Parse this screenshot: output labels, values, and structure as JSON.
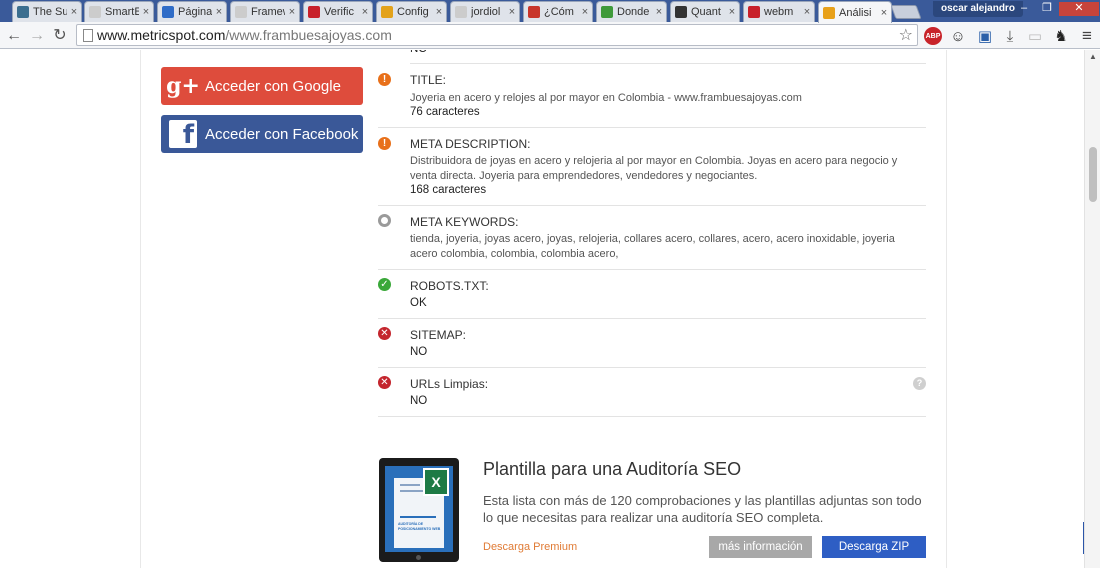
{
  "tabs": [
    {
      "title": "The Su",
      "close": "×",
      "icon": "m-logo-icon",
      "color": "#3b6e8f"
    },
    {
      "title": "SmartE",
      "close": "×",
      "icon": "page-icon",
      "color": "#cccccc"
    },
    {
      "title": "Página",
      "close": "×",
      "icon": "swirl-icon",
      "color": "#2f6cc7"
    },
    {
      "title": "Framew",
      "close": "×",
      "icon": "page-icon",
      "color": "#cccccc"
    },
    {
      "title": "Verific",
      "close": "×",
      "icon": "w-logo-icon",
      "color": "#c8202a"
    },
    {
      "title": "Config",
      "close": "×",
      "icon": "b-logo-icon",
      "color": "#e3a21a"
    },
    {
      "title": "jordiol",
      "close": "×",
      "icon": "page-icon",
      "color": "#cccccc"
    },
    {
      "title": "¿Cóm",
      "close": "×",
      "icon": "bug-icon",
      "color": "#c8352a"
    },
    {
      "title": "Donde",
      "close": "×",
      "icon": "leaf-icon",
      "color": "#3f9a3a"
    },
    {
      "title": "Quant",
      "close": "×",
      "icon": "q-logo-icon",
      "color": "#333333"
    },
    {
      "title": "webm",
      "close": "×",
      "icon": "w-logo-icon",
      "color": "#c8202a"
    },
    {
      "title": "Análisi",
      "close": "×",
      "icon": "circle-logo-icon",
      "color": "#e8a11a"
    }
  ],
  "profile": {
    "name": "oscar alejandro"
  },
  "window_controls": {
    "minimize": "–",
    "maximize": "❐",
    "close": "✕"
  },
  "toolbar": {
    "back": "←",
    "forward": "→",
    "reload": "↻",
    "url_host": "www.metricspot.com",
    "url_path": "/www.frambuesajoyas.com",
    "star": "☆",
    "extensions": [
      {
        "label": "ABP",
        "icon": "adblock-icon"
      },
      {
        "label": "☺",
        "icon": "avatar-extension-icon"
      },
      {
        "label": "▣",
        "icon": "window-extension-icon"
      },
      {
        "label": "⤓",
        "icon": "download-extension-icon"
      },
      {
        "label": "▭",
        "icon": "blank-extension-icon"
      },
      {
        "label": "♞",
        "icon": "ghost-extension-icon"
      }
    ],
    "menu": "≡"
  },
  "login": {
    "google_label": "Acceder con Google",
    "google_icon": "g+",
    "facebook_label": "Acceder con Facebook",
    "facebook_icon": "f"
  },
  "top_clipped": {
    "value": "NO"
  },
  "seo_checks": [
    {
      "label": "TITLE:",
      "status": "warn",
      "value": "Joyeria en acero y relojes al por mayor en Colombia - www.frambuesajoyas.com",
      "count": "76 caracteres"
    },
    {
      "label": "META DESCRIPTION:",
      "status": "warn",
      "value": "Distribuidora de joyas en acero y relojeria al por mayor en Colombia. Joyas en acero para negocio y venta directa. Joyeria para emprendedores, vendedores y negociantes.",
      "count": "168 caracteres"
    },
    {
      "label": "META KEYWORDS:",
      "status": "neutral",
      "value": "tienda, joyeria, joyas acero, joyas, relojeria, collares acero, collares, acero, acero inoxidable, joyeria acero colombia, colombia, colombia acero,",
      "count": ""
    },
    {
      "label": "ROBOTS.TXT:",
      "status": "ok",
      "value": "OK",
      "count": ""
    },
    {
      "label": "SITEMAP:",
      "status": "err",
      "value": "NO",
      "count": ""
    },
    {
      "label": "URLs Limpias:",
      "status": "err",
      "value": "NO",
      "count": ""
    }
  ],
  "status_symbols": {
    "warn": "!",
    "ok": "✓",
    "err": "✕",
    "neutral": ""
  },
  "help_symbol": "?",
  "promo": {
    "title": "Plantilla para una Auditoría SEO",
    "description": "Esta lista con más de 120 comprobaciones y las plantillas adjuntas son todo lo que necesitas para realizar una auditoría SEO completa.",
    "premium_link": "Descarga Premium",
    "info_button": "más información",
    "zip_button": "Descarga ZIP",
    "tablet_doc_title": "AUDITORÍA DE POSICIONAMIENTO WEB",
    "excel_letter": "X"
  }
}
